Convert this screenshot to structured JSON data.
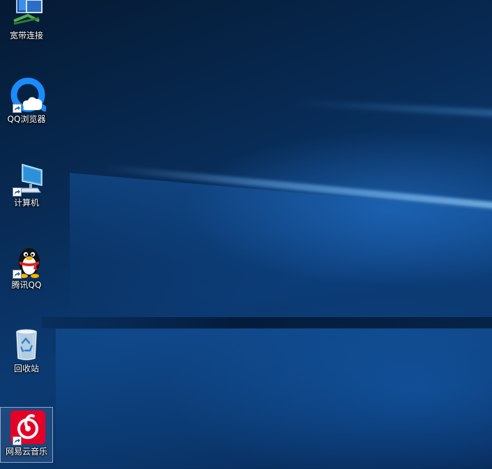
{
  "desktop": {
    "icons": [
      {
        "label": "宽带连接",
        "icon": "network-icon",
        "shortcut": false
      },
      {
        "label": "QQ浏览器",
        "icon": "qq-browser-icon",
        "shortcut": true
      },
      {
        "label": "计算机",
        "icon": "computer-icon",
        "shortcut": true
      },
      {
        "label": "腾讯QQ",
        "icon": "qq-penguin-icon",
        "shortcut": true
      },
      {
        "label": "回收站",
        "icon": "recycle-bin-icon",
        "shortcut": false
      },
      {
        "label": "网易云音乐",
        "icon": "netease-music-icon",
        "shortcut": true,
        "selected": true
      }
    ]
  },
  "colors": {
    "wallpaper_dark": "#051a33",
    "wallpaper_mid": "#0b3a72",
    "netease_red": "#e60026",
    "qq_browser_blue": "#1a8cff"
  }
}
